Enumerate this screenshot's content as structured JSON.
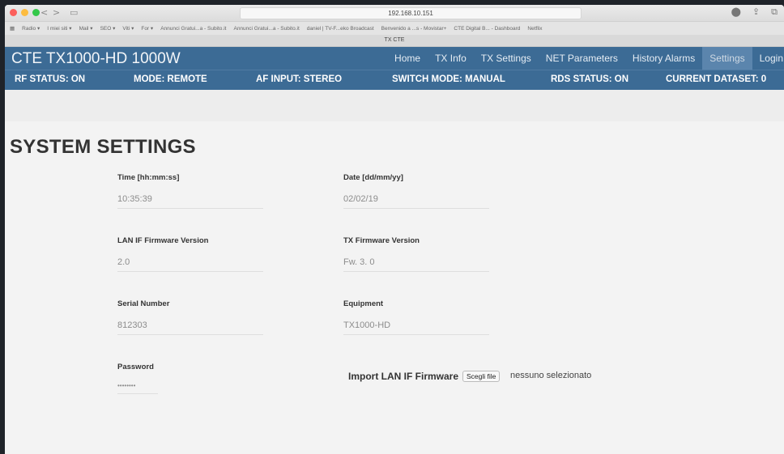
{
  "browser": {
    "address": "192.168.10.151",
    "tab_title": "TX CTE",
    "bookmarks": [
      "Radio ▾",
      "I miei siti ▾",
      "Mail ▾",
      "SEO ▾",
      "Viti ▾",
      "For ▾",
      "Annunci Gratui...a - Subito.it",
      "Annunci Gratui...a - Subito.it",
      "daniel | TV-F...eko Broadcast",
      "Benvenido a ...s - Movistar+",
      "CTE Digital B... - Dashboard",
      "Netflix"
    ]
  },
  "app": {
    "title": "CTE TX1000-HD 1000W",
    "nav": [
      "Home",
      "TX Info",
      "TX Settings",
      "NET Parameters",
      "History Alarms",
      "Settings",
      "Login"
    ],
    "active_nav": "Settings"
  },
  "status": {
    "rf": "RF STATUS: ON",
    "mode": "MODE: REMOTE",
    "af": "AF INPUT: STEREO",
    "switch": "SWITCH MODE: MANUAL",
    "rds": "RDS STATUS: ON",
    "dataset": "CURRENT DATASET: 0"
  },
  "page": {
    "title": "SYSTEM SETTINGS",
    "fields": {
      "time_label": "Time [hh:mm:ss]",
      "time_value": "10:35:39",
      "date_label": "Date [dd/mm/yy]",
      "date_value": "02/02/19",
      "lanif_label": "LAN IF Firmware Version",
      "lanif_value": "2.0",
      "txfw_label": "TX Firmware Version",
      "txfw_value": "Fw. 3. 0",
      "serial_label": "Serial Number",
      "serial_value": "812303",
      "equipment_label": "Equipment",
      "equipment_value": "TX1000-HD",
      "password_label": "Password",
      "password_value": "••••••••"
    },
    "import": {
      "label": "Import LAN IF Firmware",
      "button": "Scegli file",
      "no_file": "nessuno selezionato"
    }
  }
}
